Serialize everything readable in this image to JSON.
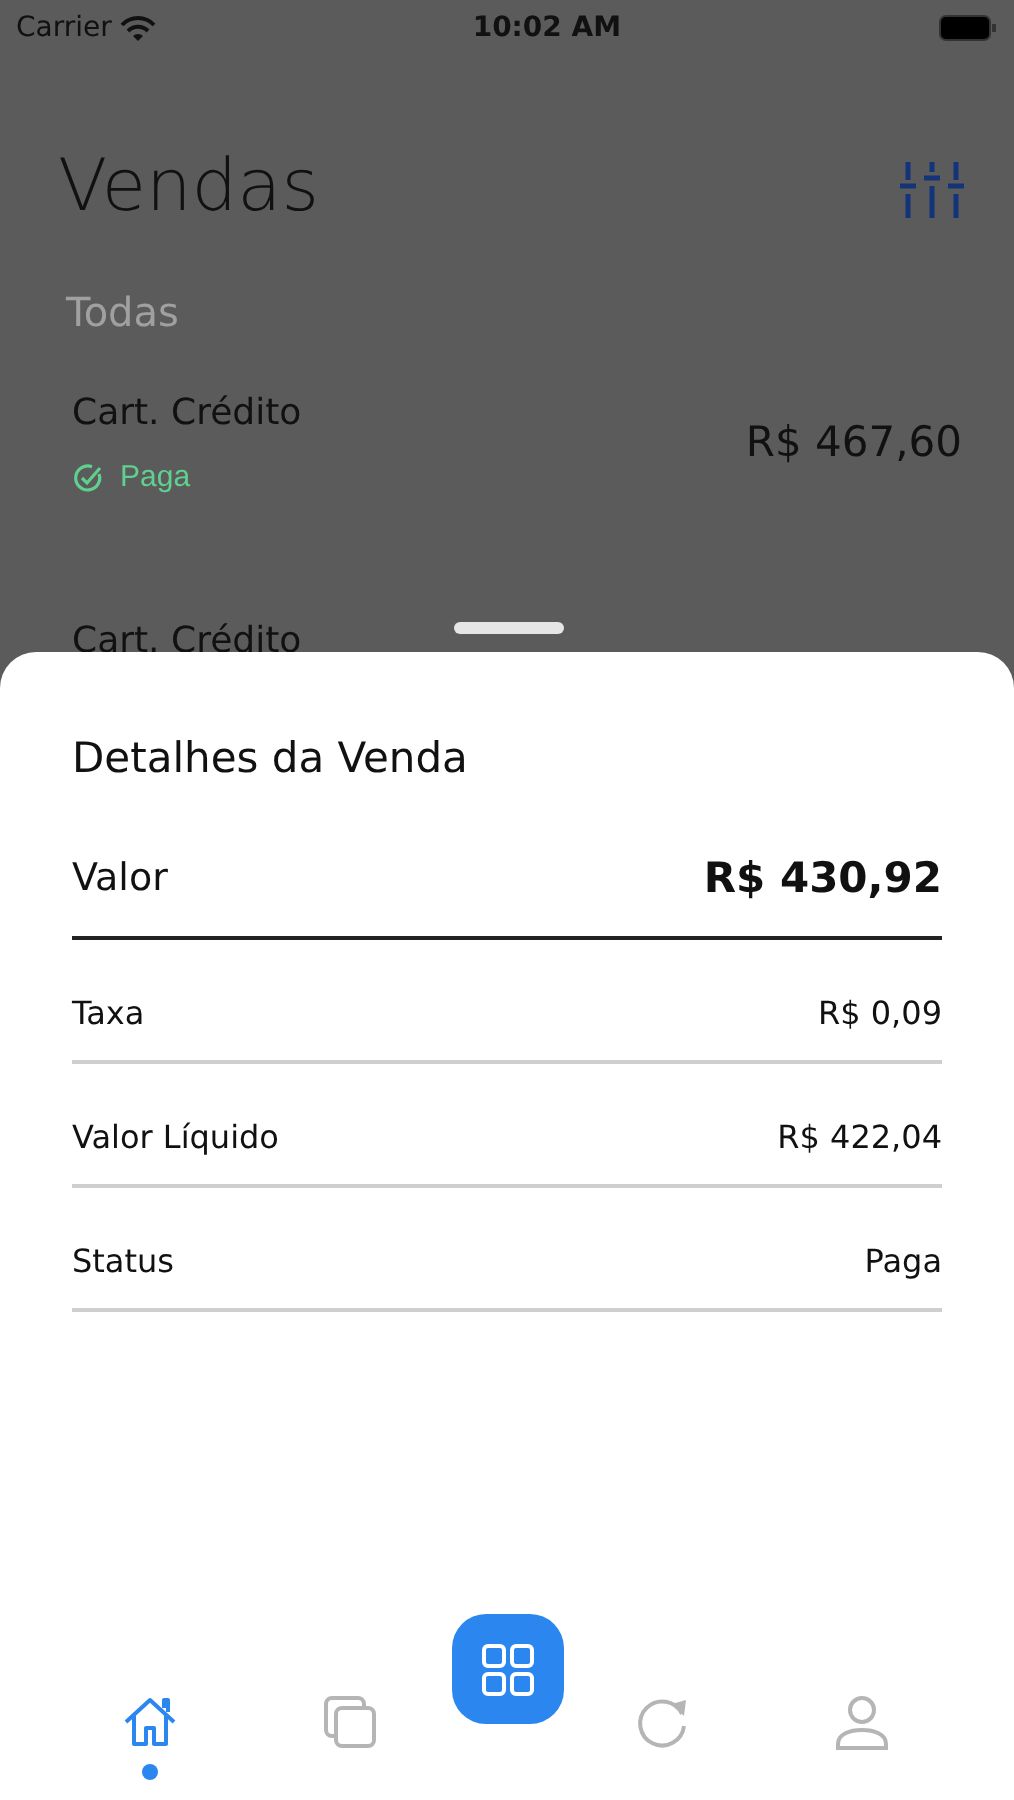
{
  "status_bar": {
    "carrier": "Carrier",
    "time": "10:02 AM"
  },
  "header": {
    "title": "Vendas"
  },
  "filter": {
    "label": "Todas"
  },
  "sales": [
    {
      "method": "Cart. Crédito",
      "status": "Paga",
      "amount": "R$ 467,60"
    },
    {
      "method": "Cart. Crédito"
    }
  ],
  "sheet": {
    "title": "Detalhes da Venda",
    "rows": [
      {
        "kind": "total",
        "label": "Valor",
        "value": "R$ 430,92"
      },
      {
        "kind": "plain",
        "label": "Taxa",
        "value": "R$ 0,09"
      },
      {
        "kind": "plain",
        "label": "Valor Líquido",
        "value": "R$ 422,04"
      },
      {
        "kind": "plain",
        "label": "Status",
        "value": "Paga"
      }
    ]
  },
  "nav": [
    {
      "kind": "home",
      "selected": true
    },
    {
      "kind": "copies",
      "selected": false
    },
    {
      "kind": "grid",
      "selected": false
    },
    {
      "kind": "refresh",
      "selected": false
    },
    {
      "kind": "person",
      "selected": false
    }
  ]
}
